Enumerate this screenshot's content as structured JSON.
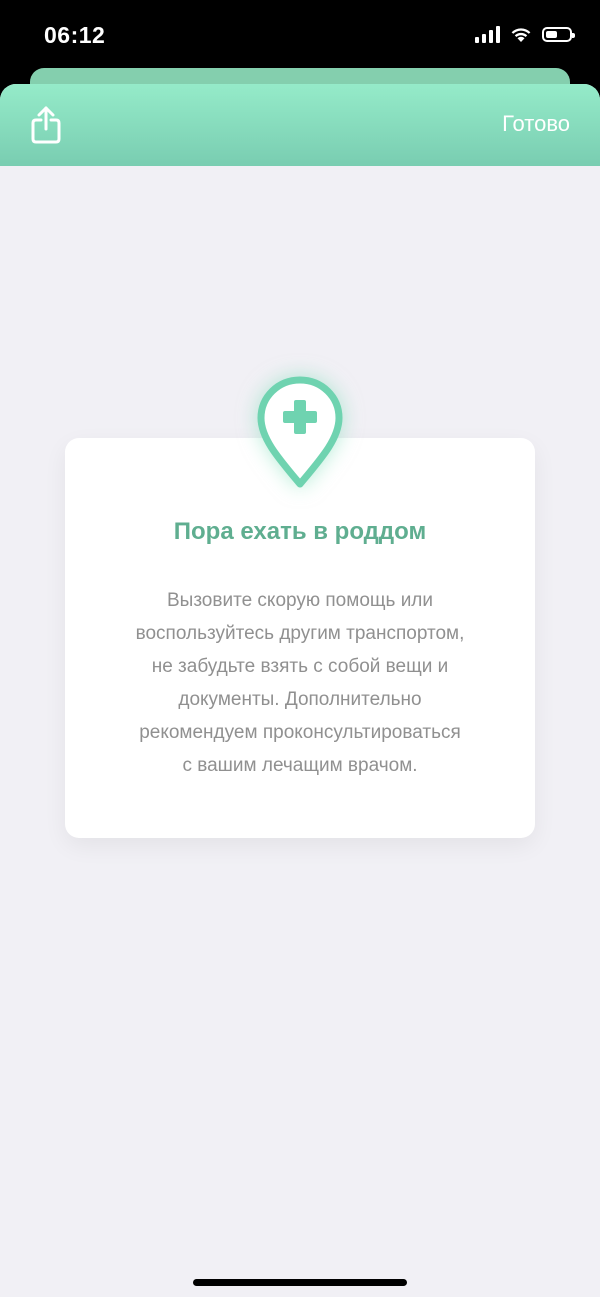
{
  "status_bar": {
    "time": "06:12",
    "battery_level": 0.5
  },
  "header": {
    "share_icon": "share-icon",
    "done_label": "Готово",
    "gradient_top": "#95ebc9",
    "gradient_bottom": "#79cdb1"
  },
  "card": {
    "icon": "hospital-location-pin-icon",
    "title": "Пора ехать в роддом",
    "body_lines": [
      "Вызовите скорую помощь или",
      "воспользуйтесь другим транспортом,",
      "не забудьте взять с собой вещи и",
      "документы. Дополнительно",
      "рекомендуем проконсультироваться",
      "с вашим лечащим врачом."
    ],
    "accent_color": "#6fd3b0",
    "title_color": "#5fae90"
  }
}
